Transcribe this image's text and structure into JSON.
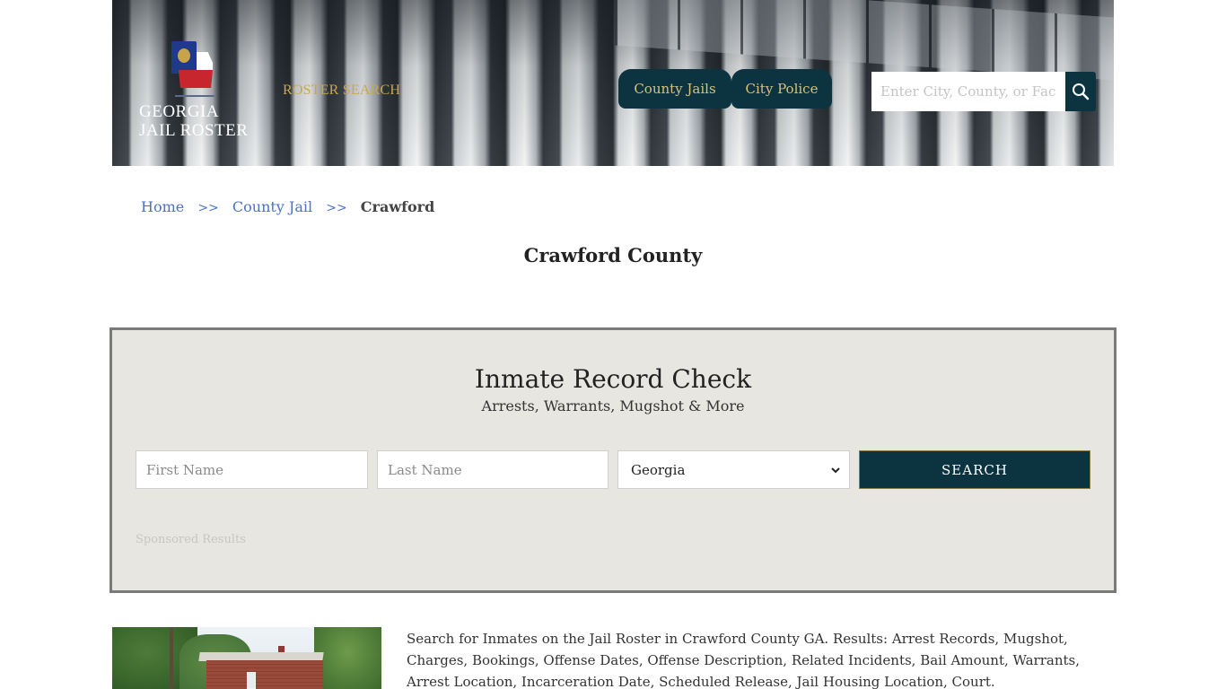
{
  "header": {
    "logo_line1": "GEORGIA",
    "logo_line2": "JAIL ROSTER",
    "roster_search_label": "ROSTER SEARCH",
    "nav": [
      {
        "label": "County Jails"
      },
      {
        "label": "City Police"
      }
    ],
    "search": {
      "placeholder": "Enter City, County, or Facility",
      "value": ""
    }
  },
  "breadcrumb": {
    "items": [
      {
        "label": "Home"
      },
      {
        "label": "County Jail"
      },
      {
        "label": "Crawford"
      }
    ],
    "separator": ">>"
  },
  "page_title": "Crawford County",
  "record_check": {
    "title": "Inmate Record Check",
    "subtitle": "Arrests, Warrants, Mugshot & More",
    "first_name_placeholder": "First Name",
    "last_name_placeholder": "Last Name",
    "state_selected": "Georgia",
    "search_label": "SEARCH",
    "sponsored_label": "Sponsored Results"
  },
  "description": "Search for Inmates on the Jail Roster in Crawford County GA. Results: Arrest Records, Mugshot, Charges, Bookings, Offense Dates, Offense Description, Related Incidents, Bail Amount, Warrants, Arrest Location, Incarceration Date, Scheduled Release, Jail Housing Location, Court.",
  "colors": {
    "brand_dark": "#0b3440",
    "brand_gold": "#c9a84c",
    "link_blue": "#4a72c8",
    "panel_bg": "#e8e6e1"
  }
}
